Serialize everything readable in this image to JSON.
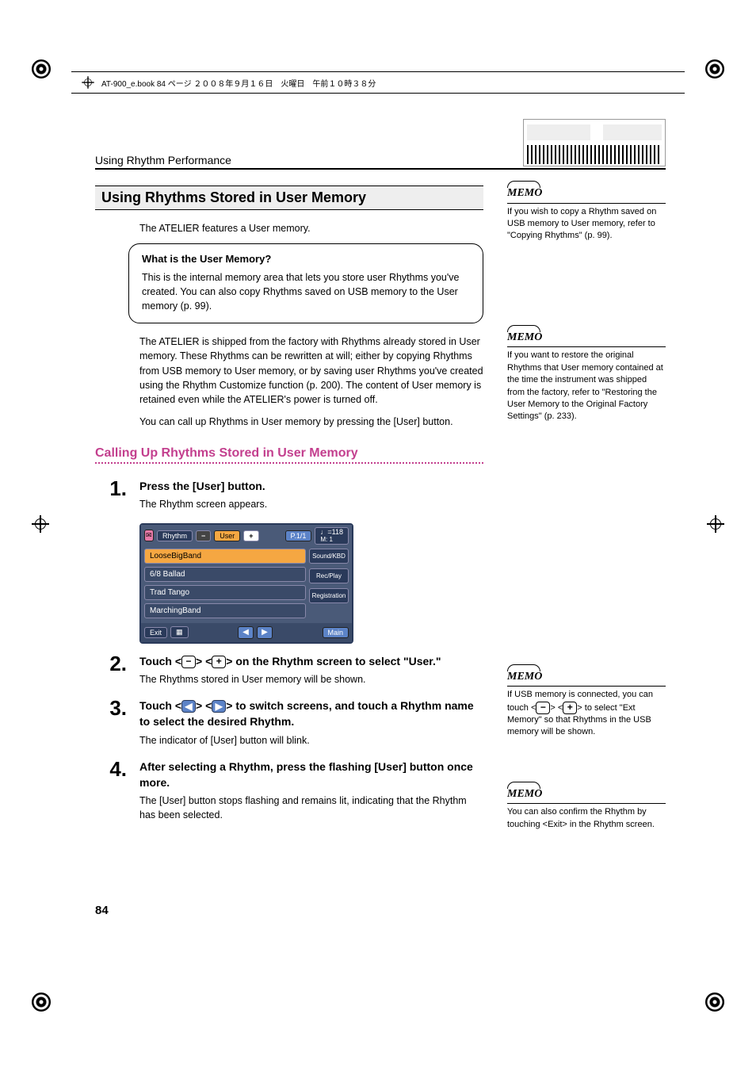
{
  "print_header": "AT-900_e.book  84 ページ  ２００８年９月１６日　火曜日　午前１０時３８分",
  "breadcrumb": "Using Rhythm Performance",
  "section_title": "Using Rhythms Stored in User Memory",
  "intro_text": "The ATELIER features a User memory.",
  "info_box": {
    "title": "What is the User Memory?",
    "body": "This is the internal memory area that lets you store user Rhythms you've created. You can also copy Rhythms saved on USB memory to the User memory (p. 99)."
  },
  "factory_para": "The ATELIER is shipped from the factory with Rhythms already stored in User memory. These Rhythms can be rewritten at will; either by copying Rhythms from USB memory to User memory, or by saving user Rhythms you've created using the Rhythm Customize function (p. 200). The content of User memory is retained even while the ATELIER's power is turned off.",
  "callup_para": "You can call up Rhythms in User memory by pressing the [User] button.",
  "subsection_title": "Calling Up Rhythms Stored in User Memory",
  "steps": [
    {
      "num": "1.",
      "head": "Press the [User] button.",
      "body": "The Rhythm screen appears."
    },
    {
      "num": "2.",
      "head_pre": "Touch <",
      "head_mid": "> <",
      "head_post": "> on the Rhythm screen to select \"User.\"",
      "body": "The Rhythms stored in User memory will be shown."
    },
    {
      "num": "3.",
      "head_pre": "Touch <",
      "head_mid": "> <",
      "head_post": "> to switch screens, and touch a Rhythm name to select the desired Rhythm.",
      "body": "The indicator of [User] button will blink."
    },
    {
      "num": "4.",
      "head": "After selecting a Rhythm, press the flashing [User] button once more.",
      "body": "The [User] button stops flashing and remains lit, indicating that the Rhythm has been selected."
    }
  ],
  "screen": {
    "title": "Rhythm",
    "user_tab": "User",
    "page_label": "P.1/1",
    "tempo_top": "♩=118",
    "tempo_sub": "M:    1",
    "items": [
      "LooseBigBand",
      "6/8 Ballad",
      "Trad Tango",
      "MarchingBand"
    ],
    "side_buttons": [
      "Sound/KBD",
      "Rec/Play",
      "Registration"
    ],
    "exit": "Exit",
    "main": "Main"
  },
  "memos": [
    {
      "label": "MEMO",
      "text": "If you wish to copy a Rhythm saved on USB memory to User memory, refer to \"Copying Rhythms\" (p. 99)."
    },
    {
      "label": "MEMO",
      "text": "If you want to restore the original Rhythms that User memory contained at the time the instrument was shipped from the factory, refer to \"Restoring the User Memory to the Original Factory Settings\" (p. 233)."
    },
    {
      "label": "MEMO",
      "text_pre": "If USB memory is connected, you can touch <",
      "text_mid": "> <",
      "text_post": "> to select \"Ext Memory\" so that Rhythms in the USB memory will be shown."
    },
    {
      "label": "MEMO",
      "text": "You can also confirm the Rhythm by touching <Exit> in the Rhythm screen."
    }
  ],
  "page_number": "84"
}
